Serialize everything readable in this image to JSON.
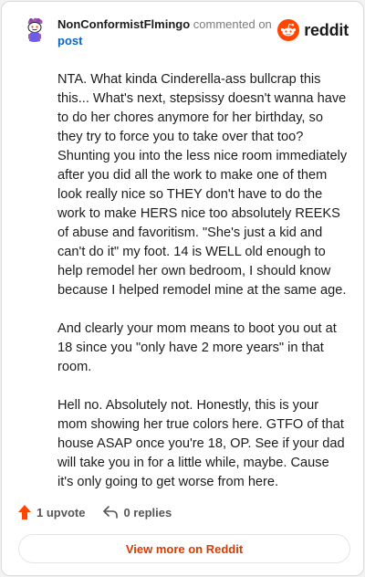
{
  "header": {
    "author": "NonConformistFlmingo",
    "commented_text": "commented on",
    "post_link": "post",
    "brand": "reddit"
  },
  "comment": {
    "paragraphs": [
      "NTA. What kinda Cinderella-ass bullcrap this this... What's next, stepsissy doesn't wanna have to do her chores anymore for her birthday, so they try to force you to take over that too? Shunting you into the less nice room immediately after you did all the work to make one of them look really nice so THEY don't have to do the work to make HERS nice too absolutely REEKS of abuse and favoritism. \"She's just a kid and can't do it\" my foot. 14 is WELL old enough to help remodel her own bedroom, I should know because I helped remodel mine at the same age.",
      "And clearly your mom means to boot you out at 18 since you \"only have 2 more years\" in that room.",
      "Hell no. Absolutely not. Honestly, this is your mom showing her true colors here. GTFO of that house ASAP once you're 18, OP. See if your dad will take you in for a little while, maybe. Cause it's only going to get worse from here."
    ]
  },
  "actions": {
    "upvote_label": "1 upvote",
    "replies_label": "0 replies"
  },
  "view_more_label": "View more on Reddit",
  "colors": {
    "brand_orange": "#ff4500",
    "link_blue": "#0a66c2",
    "view_more_text": "#d93a00"
  },
  "icons": {
    "avatar": "reddit-snoo-avatar",
    "brand": "reddit-logo-icon",
    "upvote": "upvote-arrow-icon",
    "reply": "reply-arrow-icon"
  }
}
